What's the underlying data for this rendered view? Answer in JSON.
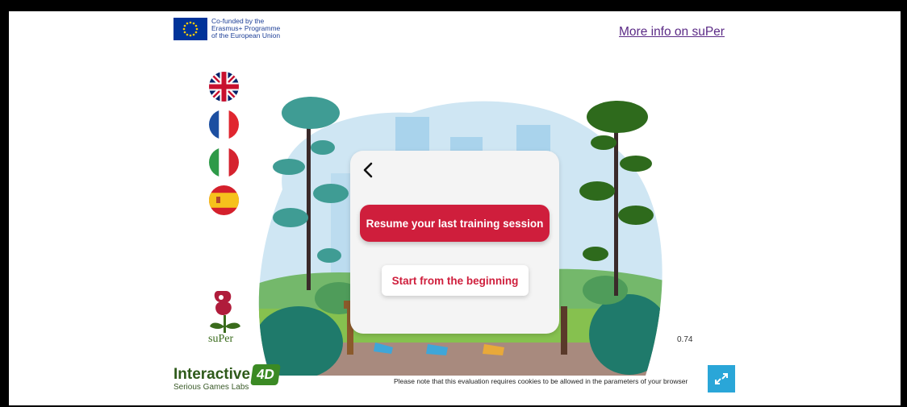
{
  "header": {
    "eu_lines": [
      "Co-funded by the",
      "Erasmus+ Programme",
      "of the European Union"
    ],
    "more_info_link": "More info on suPer"
  },
  "languages": [
    {
      "name": "english",
      "icon": "uk-flag-icon"
    },
    {
      "name": "french",
      "icon": "france-flag-icon"
    },
    {
      "name": "italian",
      "icon": "italy-flag-icon"
    },
    {
      "name": "spanish",
      "icon": "spain-flag-icon"
    }
  ],
  "dialog": {
    "back_icon": "chevron-left-icon",
    "resume_label": "Resume your last training session",
    "start_label": "Start from the beginning"
  },
  "footer": {
    "logo_text": "suPer",
    "version": "0.74",
    "brand_main": "Interactive",
    "brand_badge": "4D",
    "brand_sub": "Serious Games Labs",
    "cookie_note": "Please note that this evaluation requires cookies to be allowed in the parameters of your browser",
    "fullscreen_icon": "expand-icon"
  },
  "colors": {
    "accent_red": "#cf1e3c",
    "fullscreen_blue": "#2aa6d8",
    "link_purple": "#5b2a86"
  }
}
